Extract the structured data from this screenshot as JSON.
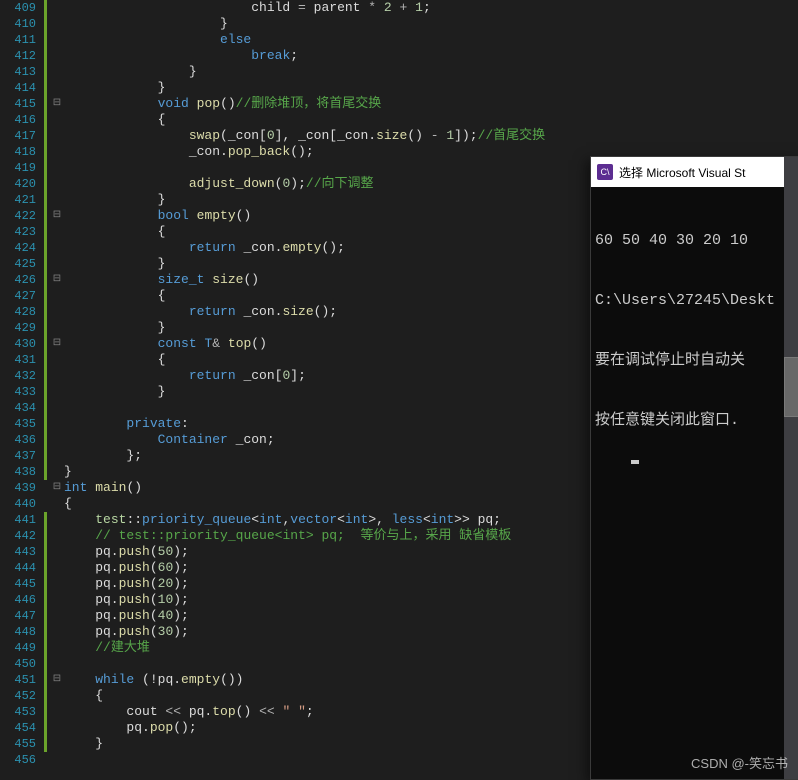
{
  "line_start": 409,
  "line_end": 456,
  "code_lines": [
    {
      "n": 409,
      "ch": true,
      "fold": "",
      "html": "                        child <span class='op'>=</span> parent <span class='op'>*</span> <span class='num'>2</span> <span class='op'>+</span> <span class='num'>1</span>;"
    },
    {
      "n": 410,
      "ch": true,
      "fold": "",
      "html": "                    }"
    },
    {
      "n": 411,
      "ch": true,
      "fold": "",
      "html": "                    <span class='kw'>else</span>"
    },
    {
      "n": 412,
      "ch": true,
      "fold": "",
      "html": "                        <span class='kw'>break</span>;"
    },
    {
      "n": 413,
      "ch": true,
      "fold": "",
      "html": "                }"
    },
    {
      "n": 414,
      "ch": true,
      "fold": "",
      "html": "            }"
    },
    {
      "n": 415,
      "ch": true,
      "fold": "⊟",
      "html": "            <span class='kw'>void</span> <span class='func'>pop</span>()<span class='comment'>//删除堆顶，将首尾交换</span>"
    },
    {
      "n": 416,
      "ch": true,
      "fold": "",
      "html": "            {"
    },
    {
      "n": 417,
      "ch": true,
      "fold": "",
      "html": "                <span class='func'>swap</span>(_con[<span class='num'>0</span>], _con[_con.<span class='func'>size</span>() <span class='op'>-</span> <span class='num'>1</span>]);<span class='comment'>//首尾交换</span>"
    },
    {
      "n": 418,
      "ch": true,
      "fold": "",
      "html": "                _con.<span class='func'>pop_back</span>();"
    },
    {
      "n": 419,
      "ch": true,
      "fold": "",
      "html": ""
    },
    {
      "n": 420,
      "ch": true,
      "fold": "",
      "html": "                <span class='func'>adjust_down</span>(<span class='num'>0</span>);<span class='comment'>//向下调整</span>"
    },
    {
      "n": 421,
      "ch": true,
      "fold": "",
      "html": "            }"
    },
    {
      "n": 422,
      "ch": true,
      "fold": "⊟",
      "html": "            <span class='kw'>bool</span> <span class='func'>empty</span>()"
    },
    {
      "n": 423,
      "ch": true,
      "fold": "",
      "html": "            {"
    },
    {
      "n": 424,
      "ch": true,
      "fold": "",
      "html": "                <span class='kw'>return</span> _con.<span class='func'>empty</span>();"
    },
    {
      "n": 425,
      "ch": true,
      "fold": "",
      "html": "            }"
    },
    {
      "n": 426,
      "ch": true,
      "fold": "⊟",
      "html": "            <span class='type'>size_t</span> <span class='func'>size</span>()"
    },
    {
      "n": 427,
      "ch": true,
      "fold": "",
      "html": "            {"
    },
    {
      "n": 428,
      "ch": true,
      "fold": "",
      "html": "                <span class='kw'>return</span> _con.<span class='func'>size</span>();"
    },
    {
      "n": 429,
      "ch": true,
      "fold": "",
      "html": "            }"
    },
    {
      "n": 430,
      "ch": true,
      "fold": "⊟",
      "html": "            <span class='kw'>const</span> <span class='type'>T</span><span class='op'>&amp;</span> <span class='func'>top</span>()"
    },
    {
      "n": 431,
      "ch": true,
      "fold": "",
      "html": "            {"
    },
    {
      "n": 432,
      "ch": true,
      "fold": "",
      "html": "                <span class='kw'>return</span> _con[<span class='num'>0</span>];"
    },
    {
      "n": 433,
      "ch": true,
      "fold": "",
      "html": "            }"
    },
    {
      "n": 434,
      "ch": true,
      "fold": "",
      "html": ""
    },
    {
      "n": 435,
      "ch": true,
      "fold": "",
      "html": "        <span class='kw'>private</span>:"
    },
    {
      "n": 436,
      "ch": true,
      "fold": "",
      "html": "            <span class='type'>Container</span> _con;"
    },
    {
      "n": 437,
      "ch": true,
      "fold": "",
      "html": "        };"
    },
    {
      "n": 438,
      "ch": true,
      "fold": "",
      "html": "}"
    },
    {
      "n": 439,
      "ch": false,
      "fold": "⊟",
      "html": "<span class='kw'>int</span> <span class='func'>main</span>()"
    },
    {
      "n": 440,
      "ch": false,
      "fold": "",
      "html": "{"
    },
    {
      "n": 441,
      "ch": true,
      "fold": "",
      "html": "    <span class='ns'>test</span>::<span class='type'>priority_queue</span>&lt;<span class='kw'>int</span>,<span class='type'>vector</span>&lt;<span class='kw'>int</span>&gt;, <span class='type'>less</span>&lt;<span class='kw'>int</span>&gt;&gt; pq;"
    },
    {
      "n": 442,
      "ch": true,
      "fold": "",
      "html": "    <span class='comment'>// test::priority_queue&lt;int&gt; pq;  等价与上，采用 缺省模板</span>"
    },
    {
      "n": 443,
      "ch": true,
      "fold": "",
      "html": "    pq.<span class='func'>push</span>(<span class='num'>50</span>);"
    },
    {
      "n": 444,
      "ch": true,
      "fold": "",
      "html": "    pq.<span class='func'>push</span>(<span class='num'>60</span>);"
    },
    {
      "n": 445,
      "ch": true,
      "fold": "",
      "html": "    pq.<span class='func'>push</span>(<span class='num'>20</span>);"
    },
    {
      "n": 446,
      "ch": true,
      "fold": "",
      "html": "    pq.<span class='func'>push</span>(<span class='num'>10</span>);"
    },
    {
      "n": 447,
      "ch": true,
      "fold": "",
      "html": "    pq.<span class='func'>push</span>(<span class='num'>40</span>);"
    },
    {
      "n": 448,
      "ch": true,
      "fold": "",
      "html": "    pq.<span class='func'>push</span>(<span class='num'>30</span>);"
    },
    {
      "n": 449,
      "ch": true,
      "fold": "",
      "html": "    <span class='comment'>//建大堆</span>"
    },
    {
      "n": 450,
      "ch": true,
      "fold": "",
      "html": ""
    },
    {
      "n": 451,
      "ch": true,
      "fold": "⊟",
      "html": "    <span class='kw'>while</span> (!pq.<span class='func'>empty</span>())"
    },
    {
      "n": 452,
      "ch": true,
      "fold": "",
      "html": "    {"
    },
    {
      "n": 453,
      "ch": true,
      "fold": "",
      "html": "        cout <span class='op'>&lt;&lt;</span> pq.<span class='func'>top</span>() <span class='op'>&lt;&lt;</span> <span class='str'>&quot; &quot;</span>;"
    },
    {
      "n": 454,
      "ch": true,
      "fold": "",
      "html": "        pq.<span class='func'>pop</span>();"
    },
    {
      "n": 455,
      "ch": true,
      "fold": "",
      "html": "    }"
    },
    {
      "n": 456,
      "ch": false,
      "fold": "",
      "html": ""
    }
  ],
  "console": {
    "icon_text": "C\\",
    "title": "选择 Microsoft Visual St",
    "lines": [
      "60 50 40 30 20 10",
      "C:\\Users\\27245\\Deskt",
      "要在调试停止时自动关",
      "按任意键关闭此窗口."
    ]
  },
  "watermark": "CSDN @-笑忘书"
}
